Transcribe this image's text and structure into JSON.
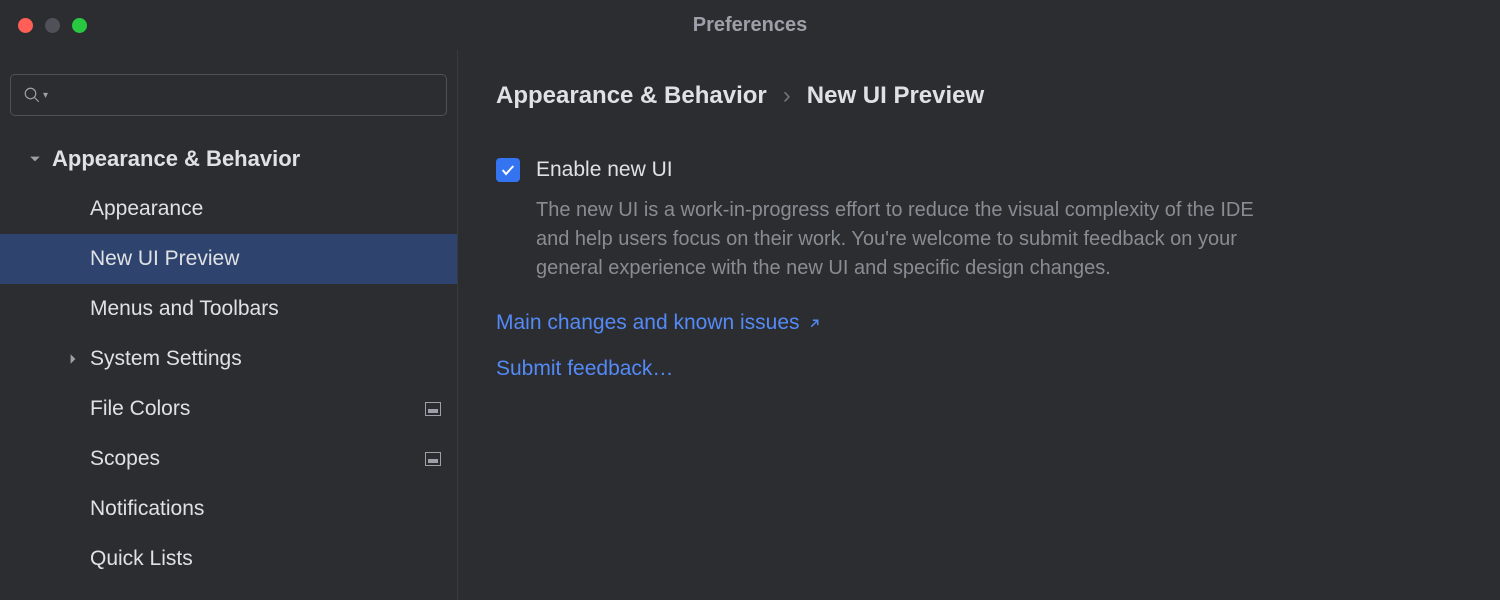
{
  "window": {
    "title": "Preferences"
  },
  "sidebar": {
    "search_placeholder": "",
    "category": {
      "label": "Appearance & Behavior"
    },
    "items": [
      {
        "label": "Appearance",
        "selected": false,
        "hasChevron": false,
        "hasBadge": false
      },
      {
        "label": "New UI Preview",
        "selected": true,
        "hasChevron": false,
        "hasBadge": false
      },
      {
        "label": "Menus and Toolbars",
        "selected": false,
        "hasChevron": false,
        "hasBadge": false
      },
      {
        "label": "System Settings",
        "selected": false,
        "hasChevron": true,
        "hasBadge": false
      },
      {
        "label": "File Colors",
        "selected": false,
        "hasChevron": false,
        "hasBadge": true
      },
      {
        "label": "Scopes",
        "selected": false,
        "hasChevron": false,
        "hasBadge": true
      },
      {
        "label": "Notifications",
        "selected": false,
        "hasChevron": false,
        "hasBadge": false
      },
      {
        "label": "Quick Lists",
        "selected": false,
        "hasChevron": false,
        "hasBadge": false
      }
    ]
  },
  "breadcrumb": {
    "part1": "Appearance & Behavior",
    "sep": "›",
    "part2": "New UI Preview"
  },
  "main": {
    "checkbox_label": "Enable new UI",
    "description": "The new UI is a work-in-progress effort to reduce the visual complexity of the IDE and help users focus on their work. You're welcome to submit feedback on your general experience with the new UI and specific design changes.",
    "link_changes": "Main changes and known issues",
    "link_feedback": "Submit feedback…"
  }
}
